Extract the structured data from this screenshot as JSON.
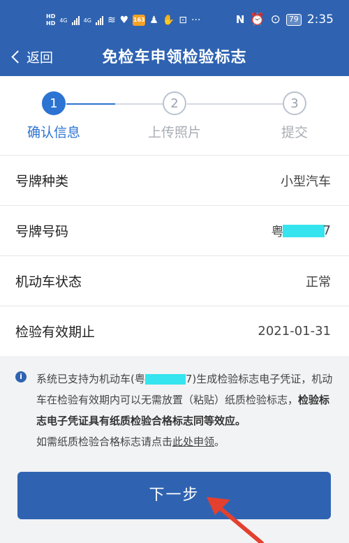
{
  "status_bar": {
    "hd1": "HD",
    "hd2": "HD",
    "net1": "4G",
    "net2": "4G",
    "app_badge": "163",
    "more": "···",
    "nfc": "N",
    "battery": "79",
    "time": "2:35"
  },
  "header": {
    "back_label": "返回",
    "title": "免检车申领检验标志"
  },
  "steps": [
    {
      "number": "1",
      "label": "确认信息",
      "active": true
    },
    {
      "number": "2",
      "label": "上传照片",
      "active": false
    },
    {
      "number": "3",
      "label": "提交",
      "active": false
    }
  ],
  "info_rows": [
    {
      "label": "号牌种类",
      "value": "小型汽车"
    },
    {
      "label": "号牌号码",
      "value_prefix": "粤",
      "value_suffix": "7"
    },
    {
      "label": "机动车状态",
      "value": "正常"
    },
    {
      "label": "检验有效期止",
      "value": "2021-01-31"
    }
  ],
  "notice": {
    "line1_a": "系统已支持为机动车(粤",
    "line1_b": "7)生成检验标志电子凭证，机动车在检验有效期内可以无需放置（粘贴）纸质检验标志，",
    "bold": "检验标志电子凭证具有纸质检验合格标志同等效应。",
    "line3_a": "如需纸质检验合格标志请点击",
    "link": "此处申领",
    "line3_b": "。"
  },
  "next_button": {
    "label": "下一步"
  },
  "colors": {
    "primary": "#2f63b1",
    "step_active": "#2c73d2",
    "mask": "#35e4ee",
    "arrow": "#e4402f"
  }
}
